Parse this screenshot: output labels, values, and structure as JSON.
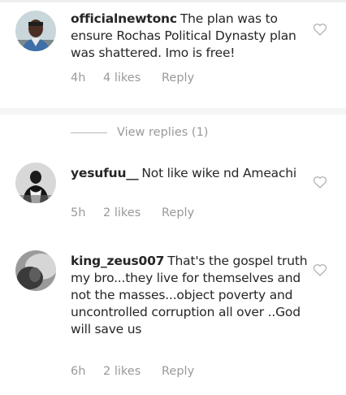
{
  "comments": [
    {
      "username": "officialnewtonc",
      "text": "The plan was to ensure Rochas Political Dynasty plan was shattered. Imo is free!",
      "time": "4h",
      "likes": "4 likes",
      "reply": "Reply"
    },
    {
      "username": "yesufuu__",
      "text": "Not like wike nd Ameachi",
      "time": "5h",
      "likes": "2 likes",
      "reply": "Reply"
    },
    {
      "username": "king_zeus007",
      "text": "That's the gospel truth my bro...they live for themselves and not the masses...object poverty and uncontrolled corruption all over ..God will save us",
      "time": "6h",
      "likes": "2 likes",
      "reply": "Reply"
    }
  ],
  "view_replies": "View replies (1)",
  "icons": {
    "like": "heart-outline-icon"
  },
  "colors": {
    "text": "#262626",
    "meta": "#999999",
    "divider": "#f5f5f5"
  }
}
